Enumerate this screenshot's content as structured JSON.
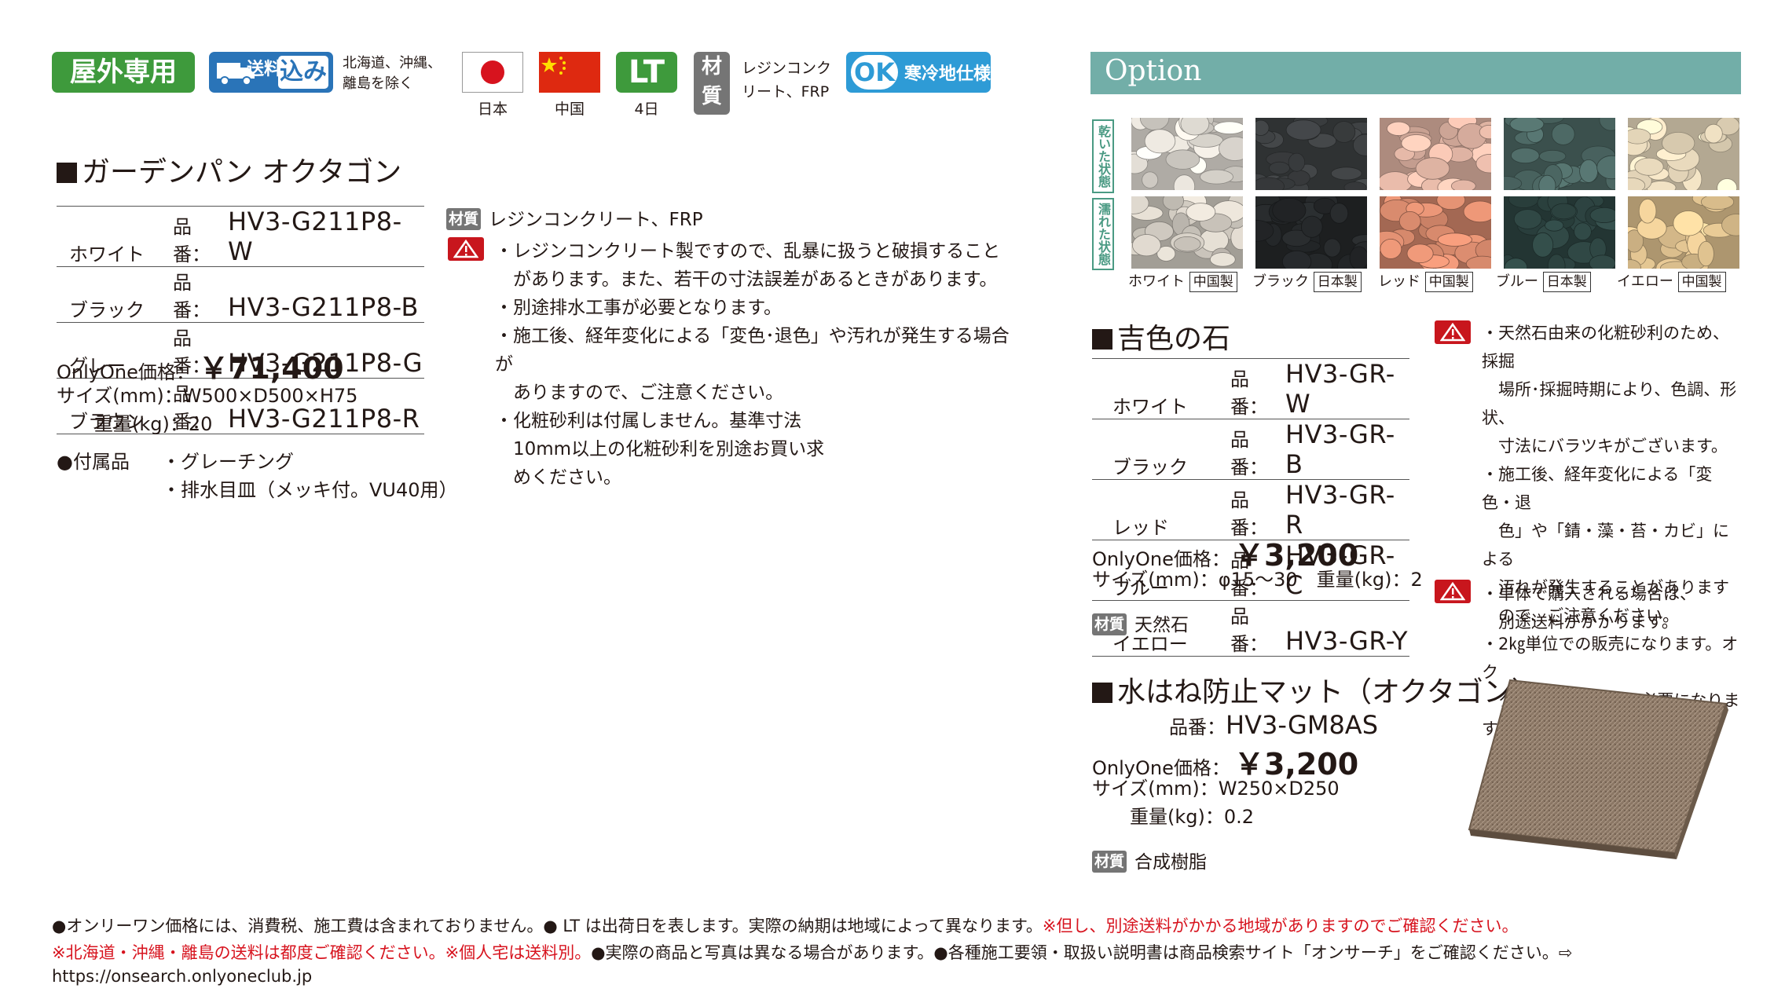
{
  "header": {
    "outdoor_label": "屋外専用",
    "shipping": {
      "label": "送料",
      "included": "込み",
      "note_line1": "北海道、沖縄、",
      "note_line2": "離島を除く"
    },
    "origins": [
      {
        "caption": "日本"
      },
      {
        "caption": "中国"
      }
    ],
    "lead_time": {
      "label": "LT",
      "caption": "4日"
    },
    "material": {
      "label_top": "材",
      "label_bottom": "質",
      "note_line1": "レジンコンク",
      "note_line2": "リート、FRP"
    },
    "cold_region": {
      "ok": "OK",
      "text": "寒冷地仕様"
    }
  },
  "main_product": {
    "title": "ガーデンパン オクタゴン",
    "variants": [
      {
        "color": "ホワイト",
        "code_label": "品番：",
        "code": "HV3-G211P8-W"
      },
      {
        "color": "ブラック",
        "code_label": "品番：",
        "code": "HV3-G211P8-B"
      },
      {
        "color": "グレー",
        "code_label": "品番：",
        "code": "HV3-G211P8-G"
      },
      {
        "color": "ブラウン",
        "code_label": "品番：",
        "code": "HV3-G211P8-R"
      }
    ],
    "price_label": "OnlyOne価格：",
    "price": "￥71,400",
    "size_label": "サイズ(mm)：",
    "size": "W500×D500×H75",
    "weight_label": "重量(kg)：",
    "weight": "20",
    "accessories_label": "●付属品",
    "accessories": [
      "・グレーチング",
      "・排水目皿（メッキ付。VU40用）"
    ],
    "material_badge": "材質",
    "material_text": "レジンコンクリート、FRP",
    "notes": [
      "・レジンコンクリート製ですので、乱暴に扱うと破損すること",
      "　があります。また、若干の寸法誤差があるときがあります。",
      "・別途排水工事が必要となります。",
      "・施工後、経年変化による「変色･退色」や汚れが発生する場合が",
      "　ありますので、ご注意ください。",
      "・化粧砂利は付属しません。基準寸法",
      "　10mm以上の化粧砂利を別途お買い求",
      "　めください。"
    ]
  },
  "option": {
    "header": "Option",
    "dry_label": "乾いた状態",
    "wet_label": "濡れた状態",
    "stones": [
      {
        "name": "ホワイト",
        "origin": "中国製",
        "dry": "#e9e4dc",
        "wet": "#d8d2c8"
      },
      {
        "name": "ブラック",
        "origin": "日本製",
        "dry": "#3f4244",
        "wet": "#26292b"
      },
      {
        "name": "レッド",
        "origin": "中国製",
        "dry": "#e6b9a8",
        "wet": "#d98b6e"
      },
      {
        "name": "ブルー",
        "origin": "日本製",
        "dry": "#4e6a66",
        "wet": "#2f4744"
      },
      {
        "name": "イエロー",
        "origin": "中国製",
        "dry": "#efe0c2",
        "wet": "#e6c894"
      }
    ],
    "stone_product": {
      "title": "吉色の石",
      "variants": [
        {
          "color": "ホワイト",
          "code_label": "品番：",
          "code": "HV3-GR-W"
        },
        {
          "color": "ブラック",
          "code_label": "品番：",
          "code": "HV3-GR-B"
        },
        {
          "color": "レッド",
          "code_label": "品番：",
          "code": "HV3-GR-R"
        },
        {
          "color": "ブルー",
          "code_label": "品番：",
          "code": "HV3-GR-C"
        },
        {
          "color": "イエロー",
          "code_label": "品番：",
          "code": "HV3-GR-Y"
        }
      ],
      "price_label": "OnlyOne価格：",
      "price": "￥3,200",
      "size_text": "サイズ(mm)：φ15～30　重量(kg)：2",
      "material_badge": "材質",
      "material_text": "天然石",
      "notes_a": [
        "・天然石由来の化粧砂利のため、採掘",
        "　場所･採掘時期により、色調、形状、",
        "　寸法にバラツキがございます。",
        "・施工後、経年変化による「変色・退",
        "　色」や「錆・藻・苔・カビ」による",
        "　汚れが発生することがあります",
        "　ので、ご注意ください。",
        "・2㎏単位での販売になります。オク",
        "　タゴンには合計4㎏必要になります。"
      ],
      "notes_b": [
        "・単体で購入される場合は、",
        "　別途送料がかかります。"
      ]
    },
    "mat_product": {
      "title": "水はね防止マット（オクタゴン）",
      "code_label": "品番：",
      "code": "HV3-GM8AS",
      "price_label": "OnlyOne価格：",
      "price": "￥3,200",
      "size_label": "サイズ(mm)：",
      "size": "W250×D250",
      "weight_label": "重量(kg)：",
      "weight": "0.2",
      "material_badge": "材質",
      "material_text": "合成樹脂"
    }
  },
  "footer": {
    "line1_black": "●オンリーワン価格には、消費税、施工費は含まれておりません。● LT は出荷日を表します。実際の納期は地域によって異なります。",
    "line1_red": "※但し、別途送料がかかる地域がありますのでご確認ください。",
    "line2_red": "※北海道・沖縄・離島の送料は都度ご確認ください。※個人宅は送料別。",
    "line2_black": "●実際の商品と写真は異なる場合があります。●各種施工要領・取扱い説明書は商品検索サイト「オンサーチ」をご確認ください。⇨ https://onsearch.onlyoneclub.jp"
  },
  "colors": {
    "green": "#3e9a3c",
    "blue": "#2a74b8",
    "option_bar": "#72aea8",
    "warning": "#c8161d",
    "note_red": "#d7131e"
  }
}
